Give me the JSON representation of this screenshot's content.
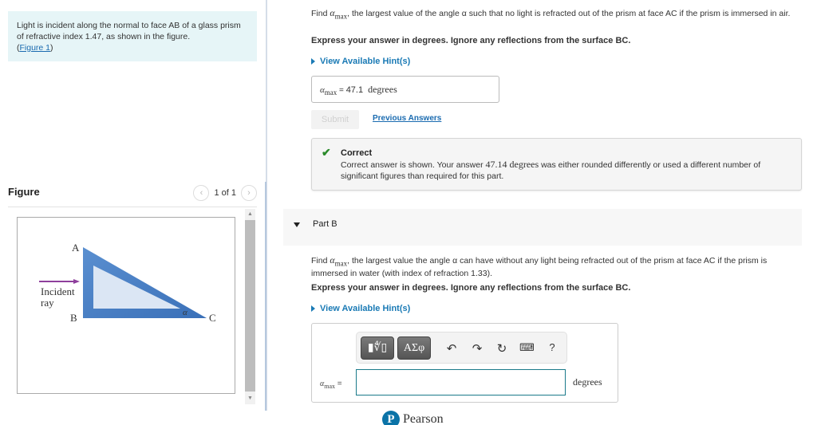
{
  "intro": {
    "text": "Light is incident along the normal to face AB of a glass prism of refractive index 1.47, as shown in the figure.",
    "link_open": "(",
    "link": "Figure 1",
    "link_close": ")"
  },
  "figure": {
    "title": "Figure",
    "pager": "1 of 1",
    "prev_icon": "‹",
    "next_icon": "›",
    "labels": {
      "a": "A",
      "b": "B",
      "c": "C",
      "alpha": "α",
      "incident": "Incident",
      "ray": "ray"
    },
    "colors": {
      "prism_edge": "#4a80c4",
      "prism_fill": "#dbe6f4",
      "ray": "#8e3f9c"
    }
  },
  "partA": {
    "question_prefix": "Find ",
    "question_var": "α",
    "question_sub": "max",
    "question_rest": ", the largest value of the angle α such that no light is refracted out of the prism at face AC if the prism is immersed in air.",
    "instruction": "Express your answer in degrees. Ignore any reflections from the surface BC.",
    "hint": "View Available Hint(s)",
    "answer_var": "α",
    "answer_sub": "max",
    "answer_eq": " = ",
    "answer_value": "47.1",
    "answer_units": "degrees",
    "submit": "Submit",
    "previous_answers": "Previous Answers",
    "feedback": {
      "status": "Correct",
      "text_before": "Correct answer is shown. Your answer ",
      "value": "47.14 degrees",
      "text_after": " was either rounded differently or used a different number of significant figures than required for this part."
    }
  },
  "partB": {
    "label": "Part B",
    "question_prefix": "Find ",
    "question_var": "α",
    "question_sub": "max",
    "question_rest": ", the largest value the angle α can have without any light being refracted out of the prism at face AC if the prism is immersed in water (with index of refraction 1.33).",
    "instruction": "Express your answer in degrees. Ignore any reflections from the surface BC.",
    "hint": "View Available Hint(s)",
    "toolbar": {
      "template_btn": "▮∜▯",
      "greek_btn": "ΑΣφ",
      "undo": "↶",
      "redo": "↷",
      "reset": "↻",
      "keyboard": "⌨",
      "help": "?"
    },
    "answer_var": "α",
    "answer_sub": "max",
    "answer_eq": " =",
    "answer_value": "",
    "answer_units": "degrees"
  },
  "footer": {
    "logo_letter": "P",
    "brand": "Pearson"
  }
}
